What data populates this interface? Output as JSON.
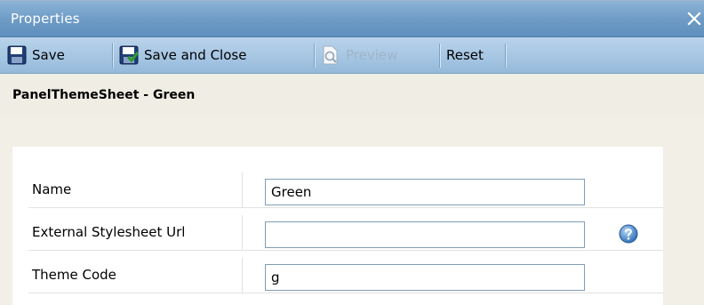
{
  "window": {
    "title": "Properties",
    "close_glyph": "✕"
  },
  "toolbar": {
    "save_label": "Save",
    "save_close_label": "Save and Close",
    "preview_label": "Preview",
    "reset_label": "Reset"
  },
  "record": {
    "title": "PanelThemeSheet - Green"
  },
  "fields": [
    {
      "label": "Name",
      "value": "Green"
    },
    {
      "label": "External Stylesheet Url",
      "value": ""
    },
    {
      "label": "Theme Code",
      "value": "g"
    }
  ],
  "icons": {
    "save": "floppy-disk-icon",
    "save_close": "save-and-close-icon",
    "preview": "preview-magnifier-icon",
    "help": "help-icon",
    "close": "close-icon"
  },
  "colors": {
    "titlebar": "#6f9cc6",
    "toolbar": "#a6c6e3",
    "panel_bg": "#f1efe6",
    "input_border": "#7f9db9"
  }
}
